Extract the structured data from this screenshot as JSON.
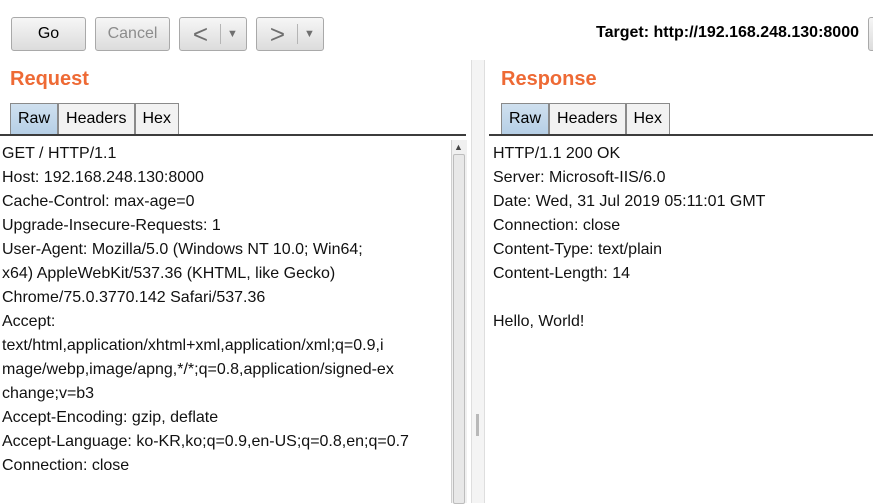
{
  "toolbar": {
    "go_label": "Go",
    "cancel_label": "Cancel",
    "back_label": "<",
    "forward_label": ">",
    "dropdown_glyph": "▼",
    "target_text": "Target: http://192.168.248.130:8000"
  },
  "request": {
    "title": "Request",
    "tabs": [
      "Raw",
      "Headers",
      "Hex"
    ],
    "active_tab": "Raw",
    "lines": [
      "GET / HTTP/1.1",
      "Host: 192.168.248.130:8000",
      "Cache-Control: max-age=0",
      "Upgrade-Insecure-Requests: 1",
      "User-Agent: Mozilla/5.0 (Windows NT 10.0; Win64;",
      "x64) AppleWebKit/537.36 (KHTML, like Gecko)",
      "Chrome/75.0.3770.142 Safari/537.36",
      "Accept:",
      "text/html,application/xhtml+xml,application/xml;q=0.9,i",
      "mage/webp,image/apng,*/*;q=0.8,application/signed-ex",
      "change;v=b3",
      "Accept-Encoding: gzip, deflate",
      "Accept-Language: ko-KR,ko;q=0.9,en-US;q=0.8,en;q=0.7",
      "Connection: close"
    ]
  },
  "response": {
    "title": "Response",
    "tabs": [
      "Raw",
      "Headers",
      "Hex"
    ],
    "active_tab": "Raw",
    "lines": [
      "HTTP/1.1 200 OK",
      "Server: Microsoft-IIS/6.0",
      "Date: Wed, 31 Jul 2019 05:11:01 GMT",
      "Connection: close",
      "Content-Type: text/plain",
      "Content-Length: 14",
      "",
      "Hello, World!"
    ]
  },
  "colors": {
    "accent": "#ee6a35",
    "active_tab": "#b6cfe6"
  }
}
